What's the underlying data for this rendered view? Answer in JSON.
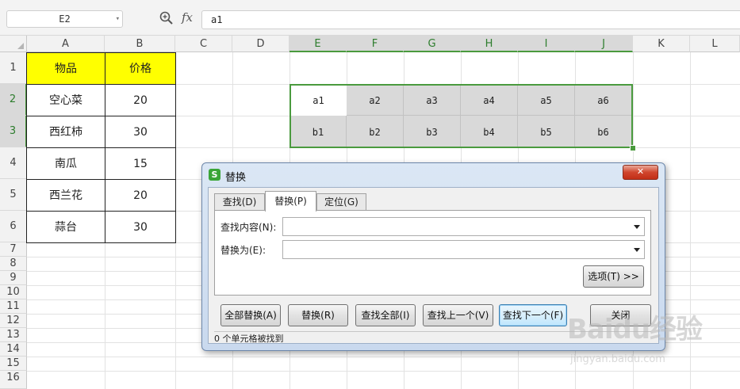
{
  "formula_bar": {
    "name_box": "E2",
    "fx_label": "fx",
    "content": "a1"
  },
  "columns": [
    "A",
    "B",
    "C",
    "D",
    "E",
    "F",
    "G",
    "H",
    "I",
    "J",
    "K",
    "L"
  ],
  "rows": [
    "1",
    "2",
    "3",
    "4",
    "5",
    "6",
    "7",
    "8",
    "9",
    "10",
    "11",
    "12",
    "13",
    "14",
    "15",
    "16"
  ],
  "table": {
    "header": [
      "物品",
      "价格"
    ],
    "rows": [
      [
        "空心菜",
        "20"
      ],
      [
        "西红柿",
        "30"
      ],
      [
        "南瓜",
        "15"
      ],
      [
        "西兰花",
        "20"
      ],
      [
        "蒜台",
        "30"
      ]
    ]
  },
  "selection_cells": {
    "row2": [
      "a1",
      "a2",
      "a3",
      "a4",
      "a5",
      "a6"
    ],
    "row3": [
      "b1",
      "b2",
      "b3",
      "b4",
      "b5",
      "b6"
    ]
  },
  "dialog": {
    "title": "替换",
    "app_icon": "S",
    "close_label": "✕",
    "tabs": [
      "查找(D)",
      "替换(P)",
      "定位(G)"
    ],
    "find_label": "查找内容(N):",
    "find_value": "",
    "replace_label": "替换为(E):",
    "replace_value": "",
    "options_button": "选项(T) >>",
    "buttons": {
      "replace_all": "全部替换(A)",
      "replace": "替换(R)",
      "find_all": "查找全部(I)",
      "find_prev": "查找上一个(V)",
      "find_next": "查找下一个(F)",
      "close": "关闭"
    },
    "status": "0 个单元格被找到"
  },
  "watermark": {
    "brand": "Baidu经验",
    "url": "jingyan.baidu.com"
  },
  "colors": {
    "header_fill": "#ffff00",
    "selection_border": "#4a9a3e",
    "selection_fill": "#d9d9d9"
  }
}
